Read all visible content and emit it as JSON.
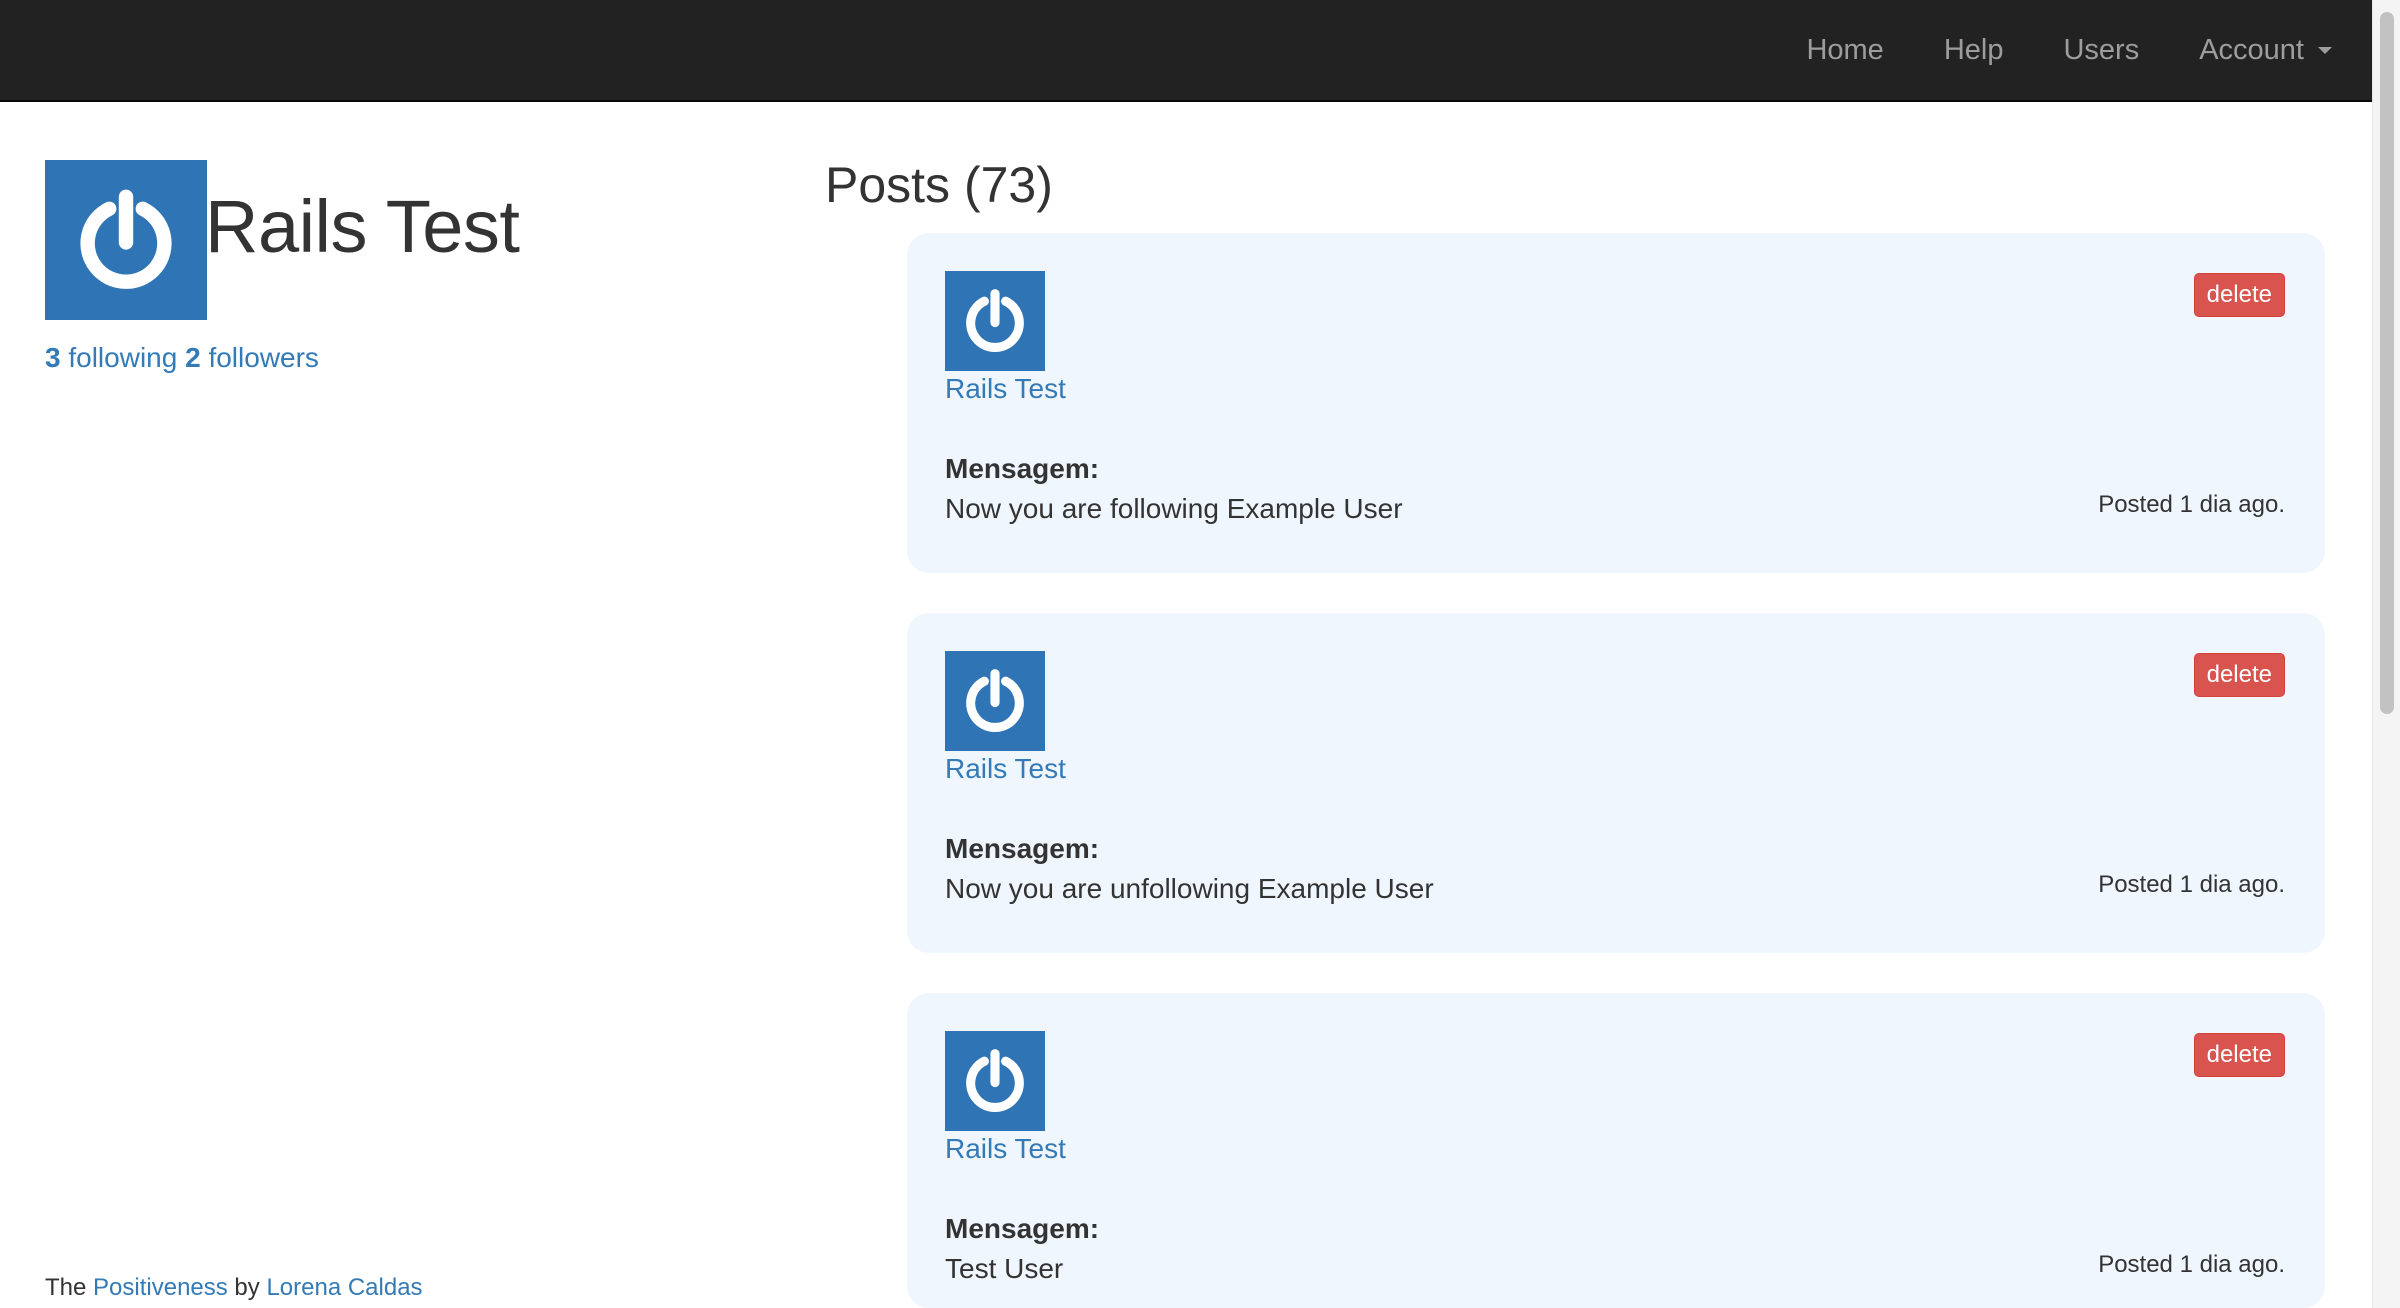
{
  "navbar": {
    "links": [
      {
        "label": "Home"
      },
      {
        "label": "Help"
      },
      {
        "label": "Users"
      },
      {
        "label": "Account"
      }
    ]
  },
  "profile": {
    "name": "Rails Test",
    "following_count": "3",
    "following_label": " following",
    "followers_count": "2",
    "followers_label": " followers"
  },
  "posts_section": {
    "title": "Posts (73)"
  },
  "posts": [
    {
      "author": "Rails Test",
      "label": "Mensagem:",
      "message": "Now you are following Example User",
      "timestamp": "Posted 1 dia ago.",
      "delete_label": "delete"
    },
    {
      "author": "Rails Test",
      "label": "Mensagem:",
      "message": "Now you are unfollowing Example User",
      "timestamp": "Posted 1 dia ago.",
      "delete_label": "delete"
    },
    {
      "author": "Rails Test",
      "label": "Mensagem:",
      "message": "Test User",
      "timestamp": "Posted 1 dia ago.",
      "delete_label": "delete"
    }
  ],
  "footer": {
    "prefix": "The ",
    "app_link": "Positiveness",
    "by": " by ",
    "author_link": "Lorena Caldas"
  },
  "colors": {
    "navbar_bg": "#222222",
    "link": "#337ab7",
    "post_bg": "#f0f6fd",
    "delete_bg": "#d9534f",
    "avatar_bg": "#2f74b5"
  },
  "icons": {
    "avatar": "power-icon",
    "account_dropdown": "caret-down-icon"
  }
}
